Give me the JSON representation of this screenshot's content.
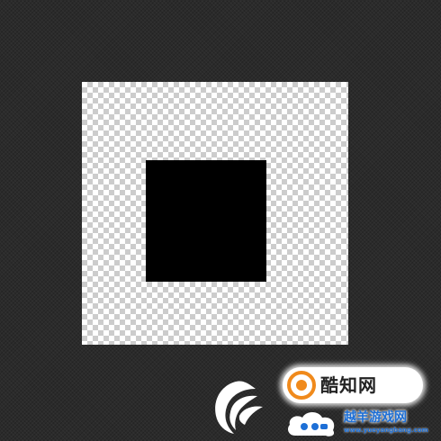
{
  "workspace": {
    "background_color": "#2b2b2b",
    "canvas": {
      "transparency_light": "#ffffff",
      "transparency_dark": "#cccccc",
      "shape": {
        "fill_color": "#000000"
      }
    }
  },
  "watermarks": {
    "leaf_logo": {
      "icon": "swirl-leaf-icon",
      "color": "#ffffff"
    },
    "badge": {
      "text": "酷知网",
      "icon": "orange-circle-icon",
      "accent": "#f08a1c"
    },
    "site": {
      "title": "越羊游戏网",
      "url": "www.yueyangbang.com",
      "icon": "blue-cloud-icon",
      "accent": "#1d6fd6"
    }
  }
}
